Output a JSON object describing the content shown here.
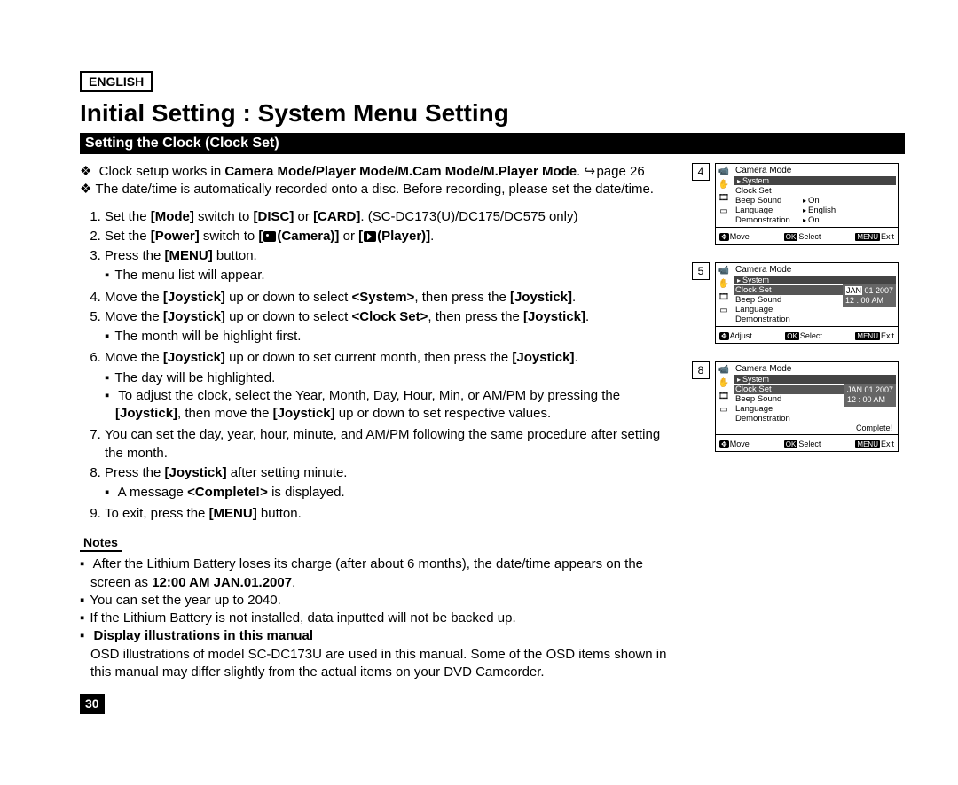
{
  "page": {
    "language_tag": "ENGLISH",
    "title": "Initial Setting : System Menu Setting",
    "section_bar": "Setting the Clock (Clock Set)",
    "page_number": "30"
  },
  "intro_bullets": [
    {
      "prefix": "Clock setup works in ",
      "bold": "Camera Mode/Player Mode/M.Cam Mode/M.Player Mode",
      "suffix": ". ",
      "hook": true,
      "page_ref": "page 26"
    },
    {
      "text": "The date/time is automatically recorded onto a disc. Before recording, please set the date/time."
    }
  ],
  "steps": {
    "s1": {
      "a": "Set the ",
      "b": "[Mode]",
      "c": " switch to ",
      "d": "[DISC]",
      "e": " or ",
      "f": "[CARD]",
      "g": ". (SC-DC173(U)/DC175/DC575 only)"
    },
    "s2": {
      "a": "Set the ",
      "b": "[Power]",
      "c": " switch to ",
      "d": "[",
      "e": "(Camera)]",
      "f": " or ",
      "g": "[",
      "h": "(Player)]",
      "i": "."
    },
    "s3": {
      "a": "Press the ",
      "b": "[MENU]",
      "c": " button.",
      "sub": "The menu list will appear."
    },
    "s4": {
      "a": "Move the ",
      "b": "[Joystick]",
      "c": " up or down to select ",
      "d": "<System>",
      "e": ", then press the ",
      "f": "[Joystick]",
      "g": "."
    },
    "s5": {
      "a": "Move the ",
      "b": "[Joystick]",
      "c": " up or down to select ",
      "d": "<Clock Set>",
      "e": ", then press the ",
      "f": "[Joystick]",
      "g": ".",
      "sub": "The month will be highlight first."
    },
    "s6": {
      "a": "Move the ",
      "b": "[Joystick]",
      "c": " up or down to set current month, then press the ",
      "d": "[Joystick]",
      "e": ".",
      "sub1": "The day will be highlighted.",
      "sub2a": "To adjust the clock, select the Year, Month, Day, Hour, Min, or AM/PM by pressing the ",
      "sub2b": "[Joystick]",
      "sub2c": ", then move the ",
      "sub2d": "[Joystick]",
      "sub2e": " up or down to set respective values."
    },
    "s7": "You can set the day, year, hour, minute, and AM/PM following the same procedure after setting the month.",
    "s8": {
      "a": "Press the ",
      "b": "[Joystick]",
      "c": " after setting minute.",
      "suba": "A message ",
      "subb": "<Complete!>",
      "subc": " is displayed."
    },
    "s9": {
      "a": "To exit, press the ",
      "b": "[MENU]",
      "c": " button."
    }
  },
  "notes": {
    "label": "Notes",
    "n1a": "After the Lithium Battery loses its charge (after about 6 months), the date/time appears on the screen as ",
    "n1b": "12:00 AM JAN.01.2007",
    "n1c": ".",
    "n2": "You can set the year up to 2040.",
    "n3": "If the Lithium Battery is not installed, data inputted will not be backed up.",
    "n4a": "Display illustrations in this manual",
    "n4b": "OSD illustrations of model SC-DC173U are used in this manual. Some of the OSD items shown in this manual may differ slightly from the actual items on your DVD Camcorder."
  },
  "osd": {
    "icons": {
      "cam": "📹",
      "hand": "✋",
      "film": "🎞",
      "card": "▭"
    },
    "mode_title": "Camera Mode",
    "crumb": "System",
    "menu": {
      "clock_set": "Clock Set",
      "beep": "Beep Sound",
      "lang": "Language",
      "demo": "Demonstration",
      "val_on": "On",
      "val_en": "English"
    },
    "footer": {
      "move": "Move",
      "adjust": "Adjust",
      "ok": "OK",
      "select": "Select",
      "menu": "MENU",
      "exit": "Exit"
    },
    "date_hl": "JAN",
    "date_rest": " 01  2007",
    "time": "12 : 00   AM",
    "complete": "Complete!"
  },
  "fig_nums": {
    "a": "4",
    "b": "5",
    "c": "8"
  }
}
